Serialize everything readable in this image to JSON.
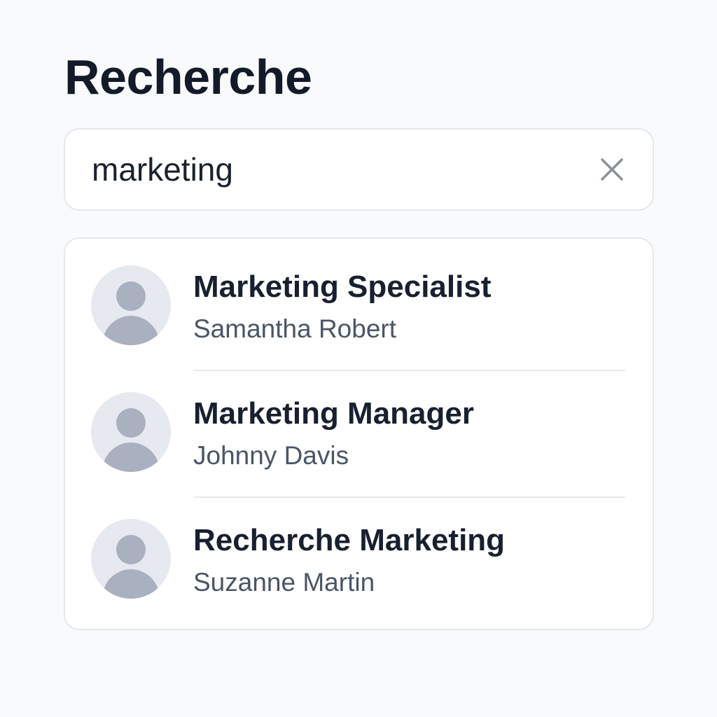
{
  "page": {
    "title": "Recherche"
  },
  "search": {
    "value": "marketing",
    "clear_icon": "close-icon"
  },
  "results": [
    {
      "title": "Marketing Specialist",
      "name": "Samantha Robert",
      "avatar_icon": "user-avatar-icon"
    },
    {
      "title": "Marketing Manager",
      "name": "Johnny Davis",
      "avatar_icon": "user-avatar-icon"
    },
    {
      "title": "Recherche Marketing",
      "name": "Suzanne Martin",
      "avatar_icon": "user-avatar-icon"
    }
  ],
  "colors": {
    "background": "#f9fafb",
    "title": "#131a2a",
    "card_border": "#e4e7ec",
    "avatar_bg": "#e6e9ef",
    "avatar_fg": "#a9b0c0",
    "subtitle": "#4a5568"
  }
}
